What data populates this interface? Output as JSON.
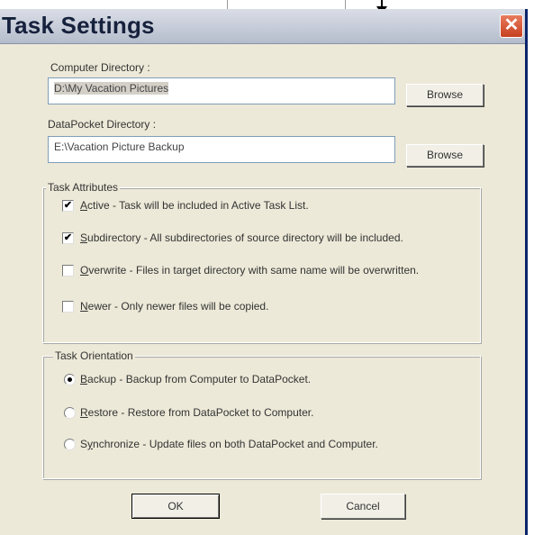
{
  "dialog": {
    "title": "Task Settings",
    "close_glyph": "✕"
  },
  "computer_dir": {
    "label": "Computer Directory :",
    "value": "D:\\My Vacation Pictures",
    "browse_label": "Browse"
  },
  "datapocket_dir": {
    "label": "DataPocket Directory :",
    "value": "E:\\Vacation Picture Backup",
    "browse_label": "Browse"
  },
  "task_attributes": {
    "legend": "Task Attributes",
    "options": [
      {
        "key": "A",
        "rest": "ctive - Task will be included in Active Task List.",
        "checked": true
      },
      {
        "key": "S",
        "rest": "ubdirectory - All subdirectories of source directory will be included.",
        "checked": true
      },
      {
        "key": "O",
        "rest": "verwrite - Files in target directory with same name will be overwritten.",
        "checked": false
      },
      {
        "key": "N",
        "rest": "ewer - Only newer files will be copied.",
        "checked": false
      }
    ]
  },
  "task_orientation": {
    "legend": "Task Orientation",
    "options": [
      {
        "key": "B",
        "rest": "ackup - Backup from Computer to DataPocket.",
        "selected": true
      },
      {
        "key": "R",
        "rest": "estore - Restore from DataPocket to Computer.",
        "selected": false
      },
      {
        "pre": "S",
        "key": "y",
        "rest": "nchronize - Update files on both DataPocket and Computer.",
        "selected": false
      }
    ]
  },
  "footer": {
    "ok_label": "OK",
    "cancel_label": "Cancel"
  }
}
